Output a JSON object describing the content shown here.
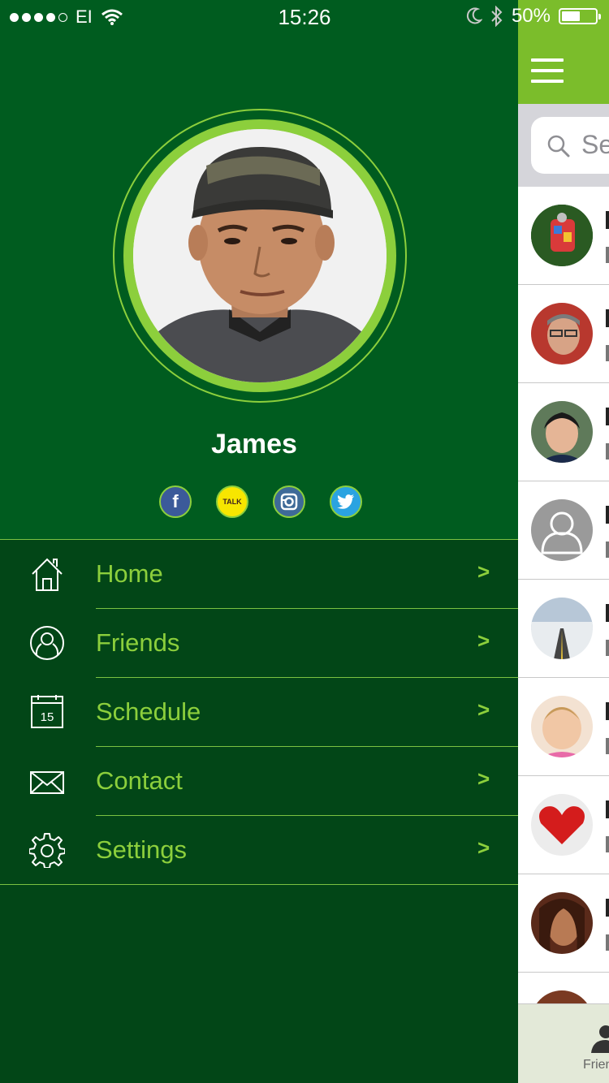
{
  "status_bar": {
    "carrier": "EI",
    "time": "15:26",
    "battery": "50%",
    "signal_bars": 4,
    "signal_total": 5
  },
  "profile": {
    "name": "James",
    "socials": [
      {
        "name": "facebook",
        "glyph": "f"
      },
      {
        "name": "kakaotalk",
        "glyph": "TALK"
      },
      {
        "name": "instagram",
        "glyph": ""
      },
      {
        "name": "twitter",
        "glyph": ""
      }
    ]
  },
  "menu": {
    "chevron": ">",
    "items": [
      {
        "label": "Home",
        "icon": "home-icon"
      },
      {
        "label": "Friends",
        "icon": "user-icon"
      },
      {
        "label": "Schedule",
        "icon": "calendar-icon",
        "icon_text": "15"
      },
      {
        "label": "Contact",
        "icon": "envelope-icon"
      },
      {
        "label": "Settings",
        "icon": "gear-icon"
      }
    ]
  },
  "behind": {
    "search_placeholder": "Se",
    "tab_label": "Frien",
    "rows": 9
  },
  "colors": {
    "drawer_bg": "#024617",
    "profile_bg": "#005c1f",
    "accent": "#8ccf3c",
    "header_green": "#7bbd2b"
  }
}
